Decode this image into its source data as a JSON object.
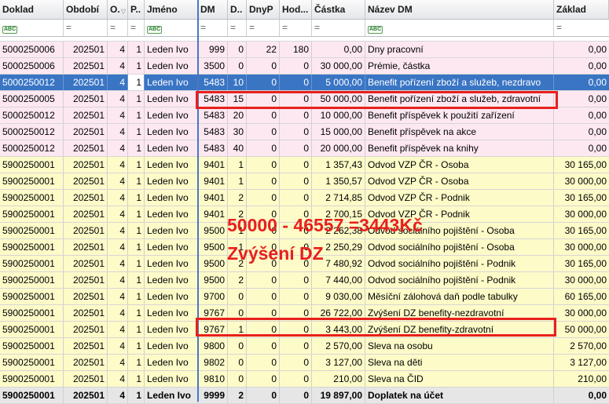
{
  "columns": [
    "Doklad",
    "Období",
    "O.",
    "P..",
    "Jméno",
    "DM",
    "D..",
    "DnyP",
    "Hod...",
    "Částka",
    "Název DM",
    "Základ"
  ],
  "filter": {
    "text_marker": "ABC",
    "equals_marker": "="
  },
  "rows": [
    {
      "doklad": "5000250006",
      "obdobi": "202501",
      "o": "4",
      "p": "1",
      "jmeno": "Leden Ivo",
      "dm": "999",
      "d": "0",
      "dnyp": "22",
      "hod": "180",
      "castka": "0,00",
      "nazev": "Dny pracovní",
      "zaklad": "0,00",
      "style": "pink"
    },
    {
      "doklad": "5000250006",
      "obdobi": "202501",
      "o": "4",
      "p": "1",
      "jmeno": "Leden Ivo",
      "dm": "3500",
      "d": "0",
      "dnyp": "0",
      "hod": "0",
      "castka": "30 000,00",
      "nazev": "Prémie, částka",
      "zaklad": "0,00",
      "style": "pink"
    },
    {
      "doklad": "5000250012",
      "obdobi": "202501",
      "o": "4",
      "p": "1",
      "jmeno": "Leden Ivo",
      "dm": "5483",
      "d": "10",
      "dnyp": "0",
      "hod": "0",
      "castka": "5 000,00",
      "nazev": "Benefit pořízení zboží a služeb, nezdravo",
      "zaklad": "0,00",
      "style": "selected"
    },
    {
      "doklad": "5000250005",
      "obdobi": "202501",
      "o": "4",
      "p": "1",
      "jmeno": "Leden Ivo",
      "dm": "5483",
      "d": "15",
      "dnyp": "0",
      "hod": "0",
      "castka": "50 000,00",
      "nazev": "Benefit pořízení zboží a služeb, zdravotní",
      "zaklad": "0,00",
      "style": "pink"
    },
    {
      "doklad": "5000250012",
      "obdobi": "202501",
      "o": "4",
      "p": "1",
      "jmeno": "Leden Ivo",
      "dm": "5483",
      "d": "20",
      "dnyp": "0",
      "hod": "0",
      "castka": "10 000,00",
      "nazev": "Benefit příspěvek k použití zařízení",
      "zaklad": "0,00",
      "style": "pink"
    },
    {
      "doklad": "5000250012",
      "obdobi": "202501",
      "o": "4",
      "p": "1",
      "jmeno": "Leden Ivo",
      "dm": "5483",
      "d": "30",
      "dnyp": "0",
      "hod": "0",
      "castka": "15 000,00",
      "nazev": "Benefit  příspěvek na akce",
      "zaklad": "0,00",
      "style": "pink"
    },
    {
      "doklad": "5000250012",
      "obdobi": "202501",
      "o": "4",
      "p": "1",
      "jmeno": "Leden Ivo",
      "dm": "5483",
      "d": "40",
      "dnyp": "0",
      "hod": "0",
      "castka": "20 000,00",
      "nazev": "Benefit  příspěvek na knihy",
      "zaklad": "0,00",
      "style": "pink"
    },
    {
      "doklad": "5900250001",
      "obdobi": "202501",
      "o": "4",
      "p": "1",
      "jmeno": "Leden Ivo",
      "dm": "9401",
      "d": "1",
      "dnyp": "0",
      "hod": "0",
      "castka": "1 357,43",
      "nazev": "Odvod VZP ČR - Osoba",
      "zaklad": "30 165,00",
      "style": "yellow"
    },
    {
      "doklad": "5900250001",
      "obdobi": "202501",
      "o": "4",
      "p": "1",
      "jmeno": "Leden Ivo",
      "dm": "9401",
      "d": "1",
      "dnyp": "0",
      "hod": "0",
      "castka": "1 350,57",
      "nazev": "Odvod VZP ČR - Osoba",
      "zaklad": "30 000,00",
      "style": "yellow"
    },
    {
      "doklad": "5900250001",
      "obdobi": "202501",
      "o": "4",
      "p": "1",
      "jmeno": "Leden Ivo",
      "dm": "9401",
      "d": "2",
      "dnyp": "0",
      "hod": "0",
      "castka": "2 714,85",
      "nazev": "Odvod VZP ČR - Podnik",
      "zaklad": "30 165,00",
      "style": "yellow"
    },
    {
      "doklad": "5900250001",
      "obdobi": "202501",
      "o": "4",
      "p": "1",
      "jmeno": "Leden Ivo",
      "dm": "9401",
      "d": "2",
      "dnyp": "0",
      "hod": "0",
      "castka": "2 700,15",
      "nazev": "Odvod VZP ČR - Podnik",
      "zaklad": "30 000,00",
      "style": "yellow"
    },
    {
      "doklad": "5900250001",
      "obdobi": "202501",
      "o": "4",
      "p": "1",
      "jmeno": "Leden Ivo",
      "dm": "9500",
      "d": "1",
      "dnyp": "0",
      "hod": "0",
      "castka": "2 262,38",
      "nazev": "Odvod sociálního pojištění - Osoba",
      "zaklad": "30 165,00",
      "style": "yellow"
    },
    {
      "doklad": "5900250001",
      "obdobi": "202501",
      "o": "4",
      "p": "1",
      "jmeno": "Leden Ivo",
      "dm": "9500",
      "d": "1",
      "dnyp": "0",
      "hod": "0",
      "castka": "2 250,29",
      "nazev": "Odvod sociálního pojištění - Osoba",
      "zaklad": "30 000,00",
      "style": "yellow"
    },
    {
      "doklad": "5900250001",
      "obdobi": "202501",
      "o": "4",
      "p": "1",
      "jmeno": "Leden Ivo",
      "dm": "9500",
      "d": "2",
      "dnyp": "0",
      "hod": "0",
      "castka": "7 480,92",
      "nazev": "Odvod sociálního pojištění - Podnik",
      "zaklad": "30 165,00",
      "style": "yellow"
    },
    {
      "doklad": "5900250001",
      "obdobi": "202501",
      "o": "4",
      "p": "1",
      "jmeno": "Leden Ivo",
      "dm": "9500",
      "d": "2",
      "dnyp": "0",
      "hod": "0",
      "castka": "7 440,00",
      "nazev": "Odvod sociálního pojištění - Podnik",
      "zaklad": "30 000,00",
      "style": "yellow"
    },
    {
      "doklad": "5900250001",
      "obdobi": "202501",
      "o": "4",
      "p": "1",
      "jmeno": "Leden Ivo",
      "dm": "9700",
      "d": "0",
      "dnyp": "0",
      "hod": "0",
      "castka": "9 030,00",
      "nazev": "Měsíční zálohová daň podle tabulky",
      "zaklad": "60 165,00",
      "style": "yellow"
    },
    {
      "doklad": "5900250001",
      "obdobi": "202501",
      "o": "4",
      "p": "1",
      "jmeno": "Leden Ivo",
      "dm": "9767",
      "d": "0",
      "dnyp": "0",
      "hod": "0",
      "castka": "26 722,00",
      "nazev": "Zvýšení DZ benefity-nezdravotní",
      "zaklad": "30 000,00",
      "style": "yellow"
    },
    {
      "doklad": "5900250001",
      "obdobi": "202501",
      "o": "4",
      "p": "1",
      "jmeno": "Leden Ivo",
      "dm": "9767",
      "d": "1",
      "dnyp": "0",
      "hod": "0",
      "castka": "3 443,00",
      "nazev": "Zvýšení DZ benefity-zdravotní",
      "zaklad": "50 000,00",
      "style": "yellow"
    },
    {
      "doklad": "5900250001",
      "obdobi": "202501",
      "o": "4",
      "p": "1",
      "jmeno": "Leden Ivo",
      "dm": "9800",
      "d": "0",
      "dnyp": "0",
      "hod": "0",
      "castka": "2 570,00",
      "nazev": "Sleva na osobu",
      "zaklad": "2 570,00",
      "style": "yellow"
    },
    {
      "doklad": "5900250001",
      "obdobi": "202501",
      "o": "4",
      "p": "1",
      "jmeno": "Leden Ivo",
      "dm": "9802",
      "d": "0",
      "dnyp": "0",
      "hod": "0",
      "castka": "3 127,00",
      "nazev": "Sleva na děti",
      "zaklad": "3 127,00",
      "style": "yellow"
    },
    {
      "doklad": "5900250001",
      "obdobi": "202501",
      "o": "4",
      "p": "1",
      "jmeno": "Leden Ivo",
      "dm": "9810",
      "d": "0",
      "dnyp": "0",
      "hod": "0",
      "castka": "210,00",
      "nazev": "Sleva na ČID",
      "zaklad": "210,00",
      "style": "yellow"
    },
    {
      "doklad": "5900250001",
      "obdobi": "202501",
      "o": "4",
      "p": "1",
      "jmeno": "Leden Ivo",
      "dm": "9999",
      "d": "2",
      "dnyp": "0",
      "hod": "0",
      "castka": "19 897,00",
      "nazev": "Doplatek na účet",
      "zaklad": "0,00",
      "style": "gray"
    }
  ],
  "annotation": {
    "formula": "50000 - 46557 =3443Kč",
    "label": "Zvýšení DZ",
    "color": "#e8201c"
  },
  "colors": {
    "selection": "#3a75c4",
    "pink_row": "#fde8f1",
    "yellow_row": "#fdfbc8",
    "total_row": "#e6e6e6"
  }
}
